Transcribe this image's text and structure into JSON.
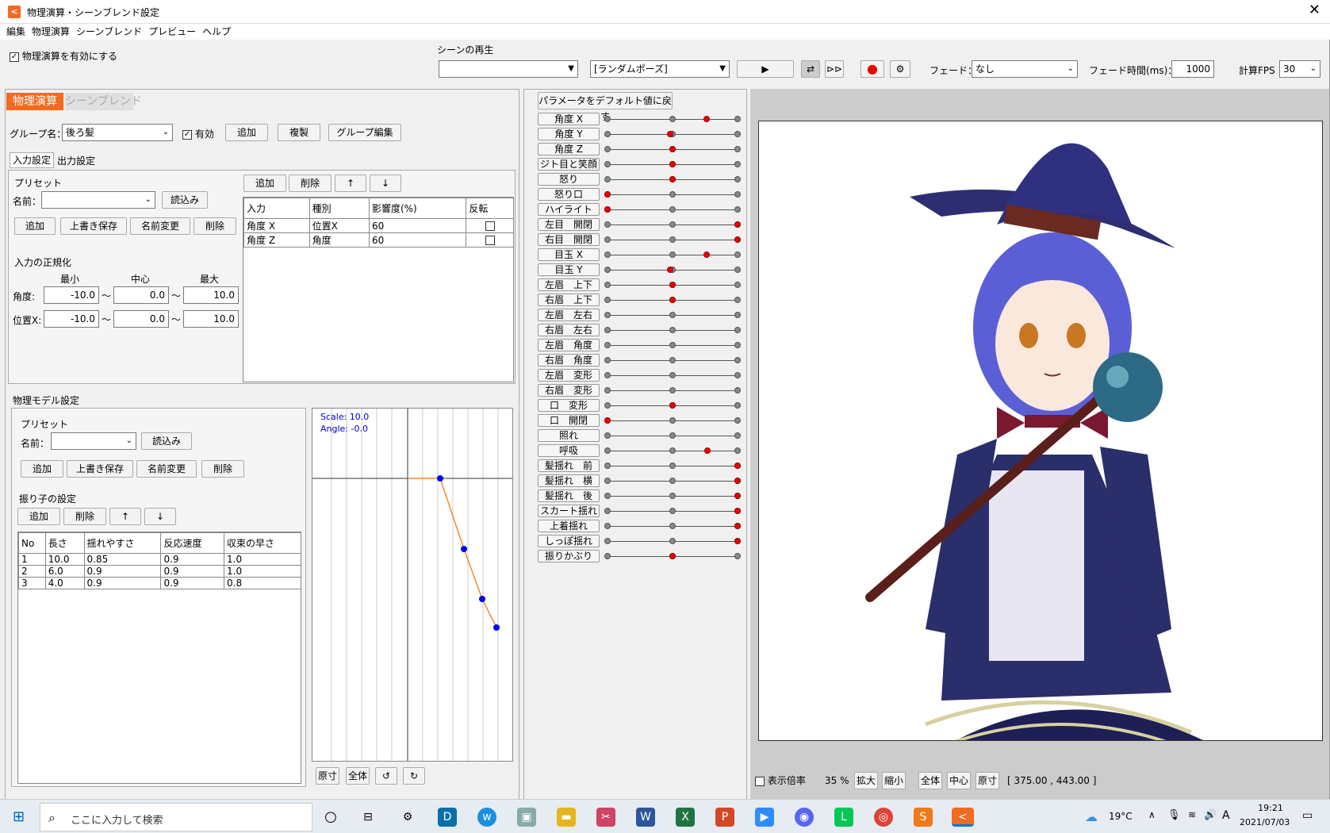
{
  "window": {
    "title": "物理演算・シーンブレンド設定"
  },
  "menu": [
    "編集",
    "物理演算",
    "シーンブレンド",
    "プレビュー",
    "ヘルプ"
  ],
  "top": {
    "enable_physics": "物理演算を有効にする",
    "scene_play": "シーンの再生",
    "scene_select": "[ランダムポーズ]",
    "fade_label": "フェード：",
    "fade_value": "なし",
    "fade_time_label": "フェード時間(ms)：",
    "fade_time_value": "1000",
    "fps_label": "計算FPS",
    "fps_value": "30"
  },
  "tabs": {
    "physics": "物理演算",
    "scene": "シーンブレンド"
  },
  "group": {
    "label": "グループ名：",
    "value": "後ろ髪",
    "enabled": "有効",
    "add": "追加",
    "copy": "複製",
    "edit": "グループ編集"
  },
  "subtabs": {
    "input": "入力設定",
    "output": "出力設定"
  },
  "preset": {
    "title": "プリセット",
    "name": "名前：",
    "load": "読込み",
    "add": "追加",
    "overwrite": "上書き保存",
    "rename": "名前変更",
    "delete": "削除"
  },
  "normalize": {
    "title": "入力の正規化",
    "min": "最小",
    "center": "中心",
    "max": "最大",
    "angle_label": "角度:",
    "angle_min": "-10.0",
    "angle_center": "0.0",
    "angle_max": "10.0",
    "posx_label": "位置X:",
    "posx_min": "-10.0",
    "posx_center": "0.0",
    "posx_max": "10.0",
    "tilde": "～"
  },
  "input_table": {
    "add": "追加",
    "delete": "削除",
    "up": "↑",
    "down": "↓",
    "headers": [
      "入力",
      "種別",
      "影響度(%)",
      "反転"
    ],
    "rows": [
      [
        "角度 X",
        "位置X",
        "60"
      ],
      [
        "角度 Z",
        "角度",
        "60"
      ]
    ]
  },
  "model": {
    "title": "物理モデル設定",
    "preset": "プリセット",
    "name": "名前：",
    "load": "読込み",
    "add": "追加",
    "overwrite": "上書き保存",
    "rename": "名前変更",
    "delete": "削除",
    "pendulum": "振り子の設定",
    "p_add": "追加",
    "p_delete": "削除",
    "p_up": "↑",
    "p_down": "↓",
    "headers": [
      "No",
      "長さ",
      "揺れやすさ",
      "反応速度",
      "収束の早さ"
    ],
    "rows": [
      [
        "1",
        "10.0",
        "0.85",
        "0.9",
        "1.0"
      ],
      [
        "2",
        "6.0",
        "0.9",
        "0.9",
        "1.0"
      ],
      [
        "3",
        "4.0",
        "0.9",
        "0.9",
        "0.8"
      ]
    ]
  },
  "graph": {
    "scale": "Scale: 10.0",
    "angle": "Angle: -0.0",
    "b1": "原寸",
    "b2": "全体",
    "b3": "↺",
    "b4": "↻"
  },
  "params": {
    "reset": "パラメータをデフォルト値に戻す",
    "items": [
      "角度 X",
      "角度 Y",
      "角度 Z",
      "ジト目と笑顔",
      "怒り",
      "怒り口",
      "ハイライト",
      "左目　開閉",
      "右目　開閉",
      "目玉 X",
      "目玉 Y",
      "左眉　上下",
      "右眉　上下",
      "左眉　左右",
      "右眉　左右",
      "左眉　角度",
      "右眉　角度",
      "左眉　変形",
      "右眉　変形",
      "口　変形",
      "口　開閉",
      "照れ",
      "呼吸",
      "髪揺れ　前",
      "髪揺れ　横",
      "髪揺れ　後",
      "スカート揺れ",
      "上着揺れ",
      "しっぽ揺れ",
      "振りかぶり"
    ]
  },
  "preview": {
    "zoom_label": "表示倍率",
    "zoom_value": "35 %",
    "zin": "拡大",
    "zout": "縮小",
    "all": "全体",
    "center": "中心",
    "orig": "原寸",
    "coords": "[ 375.00 , 443.00 ]"
  },
  "taskbar": {
    "search": "ここに入力して検索",
    "weather": "19°C",
    "ime": "A",
    "time": "19:21",
    "date": "2021/07/03"
  }
}
